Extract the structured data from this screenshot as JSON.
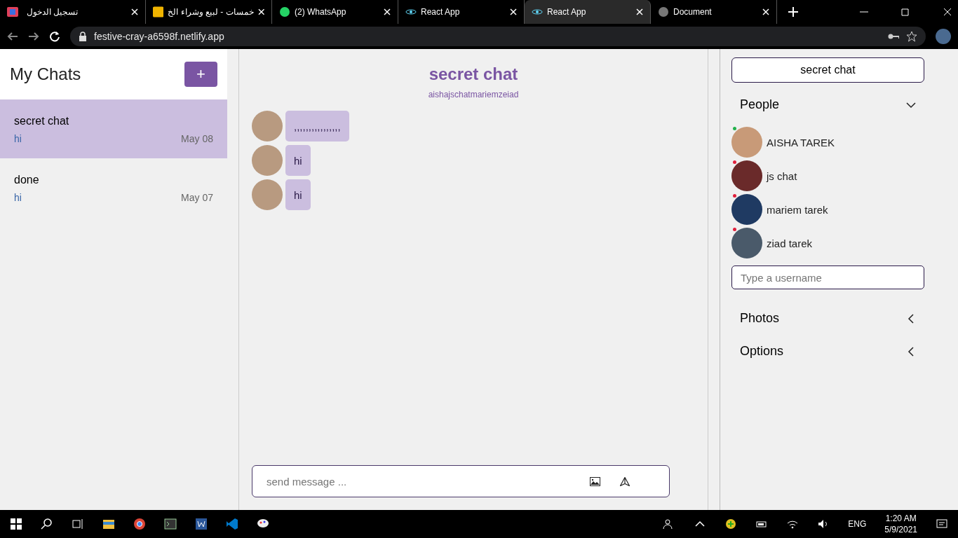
{
  "browser": {
    "tabs": [
      {
        "title": "تسجيل الدخول",
        "selected": false
      },
      {
        "title": "خمسات - لبيع وشراء الخ",
        "selected": false
      },
      {
        "title": "(2) WhatsApp",
        "selected": false
      },
      {
        "title": "React App",
        "selected": false
      },
      {
        "title": "React App",
        "selected": true
      },
      {
        "title": "Document",
        "selected": false
      }
    ],
    "url": "festive-cray-a6598f.netlify.app"
  },
  "chat_list": {
    "title": "My Chats",
    "add_button": "+",
    "chats": [
      {
        "title": "secret chat",
        "last_message": "hi",
        "date": "May 08",
        "selected": true
      },
      {
        "title": "done",
        "last_message": "hi",
        "date": "May 07",
        "selected": false
      }
    ]
  },
  "chat_feed": {
    "title": "secret chat",
    "members": "aishajschatmariemzeiad",
    "messages": [
      {
        "text": ",,,,,,,,,,,,,,,,"
      },
      {
        "text": "hi"
      },
      {
        "text": "hi"
      }
    ],
    "input": {
      "placeholder": "send message ..."
    }
  },
  "settings": {
    "chat_title": "secret chat",
    "sections": [
      {
        "title": "People",
        "expanded": true
      },
      {
        "title": "Photos",
        "expanded": false
      },
      {
        "title": "Options",
        "expanded": false
      }
    ],
    "people": [
      {
        "name": "AISHA TAREK",
        "color": "#22b14c"
      },
      {
        "name": "js chat",
        "color": "#e0203c"
      },
      {
        "name": "mariem tarek",
        "color": "#e0203c"
      },
      {
        "name": "ziad tarek",
        "color": "#e0203c"
      }
    ],
    "username_input": {
      "placeholder": "Type a username"
    }
  },
  "taskbar": {
    "language": "ENG",
    "time": "1:20 AM",
    "date": "5/9/2021"
  }
}
